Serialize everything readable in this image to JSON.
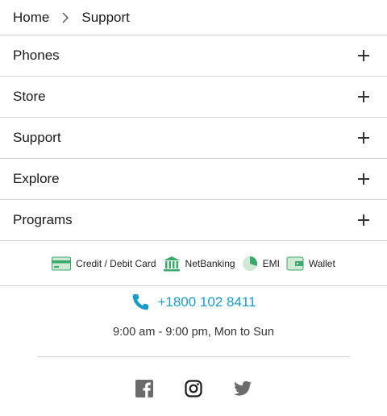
{
  "breadcrumb": {
    "home": "Home",
    "current": "Support"
  },
  "accordion": [
    {
      "label": "Phones"
    },
    {
      "label": "Store"
    },
    {
      "label": "Support"
    },
    {
      "label": "Explore"
    },
    {
      "label": "Programs"
    }
  ],
  "payments": [
    {
      "label": "Credit / Debit Card",
      "icon": "credit-card-icon"
    },
    {
      "label": "NetBanking",
      "icon": "bank-icon"
    },
    {
      "label": "EMI",
      "icon": "pie-chart-icon"
    },
    {
      "label": "Wallet",
      "icon": "wallet-icon"
    }
  ],
  "contact": {
    "phone": "+1800 102 8411",
    "hours": "9:00 am - 9:00 pm, Mon to Sun"
  },
  "social": [
    "facebook-icon",
    "instagram-icon",
    "twitter-icon"
  ],
  "colors": {
    "accent": "#1a9bcb",
    "payment_green": "#3aa86b",
    "payment_green_light": "#cfe9d5",
    "social_gray": "#6b6b6b"
  }
}
